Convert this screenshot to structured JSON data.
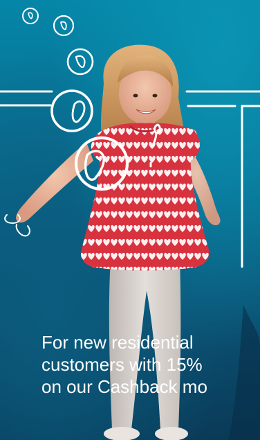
{
  "hero": {
    "caption_lines": [
      "For new residential",
      "customers with 15%",
      "on our Cashback mo"
    ]
  },
  "icons": {
    "bubbles": "drop-bubble-icon",
    "lines": "doodle-lines-icon"
  },
  "colors": {
    "background_top": "#0586a8",
    "background_bottom": "#0a3a57",
    "doodle_stroke": "#ffffff",
    "shirt": "#d8323f",
    "pants": "#d9d3cf",
    "hair": "#c9925a",
    "text": "#ffffff"
  }
}
